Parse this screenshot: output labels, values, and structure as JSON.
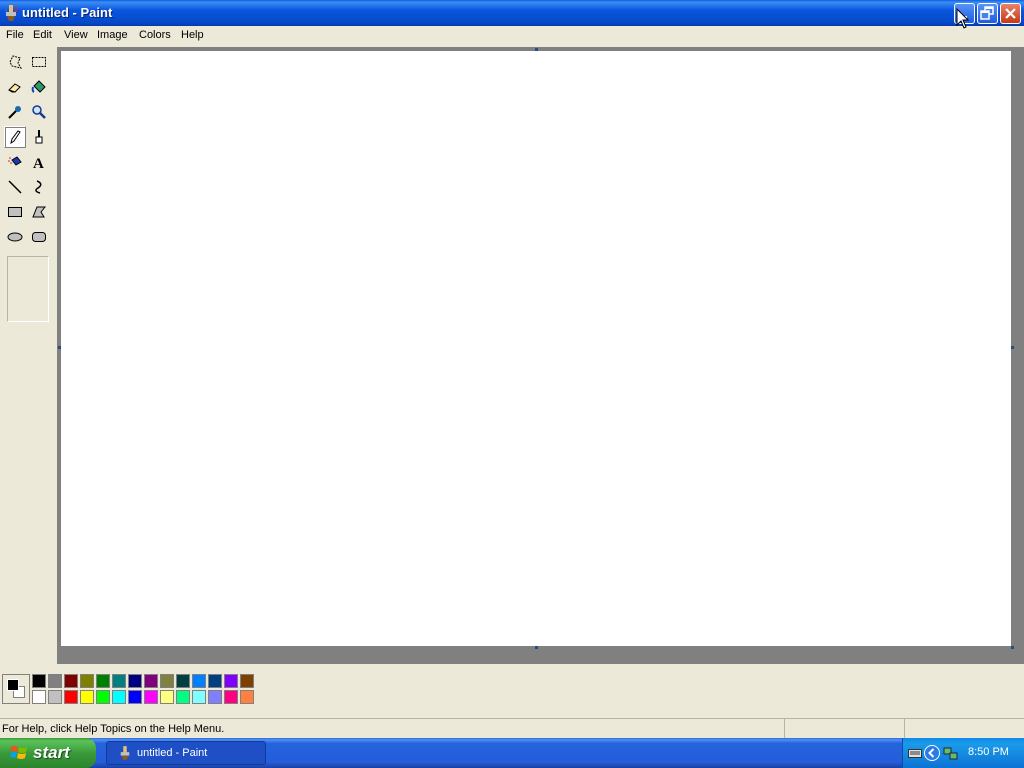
{
  "window": {
    "title": "untitled - Paint"
  },
  "menu": [
    "File",
    "Edit",
    "View",
    "Image",
    "Colors",
    "Help"
  ],
  "tools": [
    "free-form-select",
    "select",
    "eraser",
    "fill-with-color",
    "pick-color",
    "magnifier",
    "pencil",
    "brush",
    "airbrush",
    "text",
    "line",
    "curve",
    "rectangle",
    "polygon",
    "ellipse",
    "rounded-rectangle"
  ],
  "selected_tool": "pencil",
  "palette": {
    "foreground": "#000000",
    "background": "#FFFFFF",
    "top_row": [
      "#000000",
      "#808080",
      "#800000",
      "#808000",
      "#008000",
      "#008080",
      "#000080",
      "#800080",
      "#808040",
      "#004040",
      "#0080FF",
      "#004080",
      "#8000FF",
      "#804000"
    ],
    "bottom_row": [
      "#FFFFFF",
      "#C0C0C0",
      "#FF0000",
      "#FFFF00",
      "#00FF00",
      "#00FFFF",
      "#0000FF",
      "#FF00FF",
      "#FFFF80",
      "#00FF80",
      "#80FFFF",
      "#8080FF",
      "#FF0080",
      "#FF8040"
    ]
  },
  "status": {
    "help_text": "For Help, click Help Topics on the Help Menu."
  },
  "taskbar": {
    "start_label": "start",
    "task_label": "untitled - Paint",
    "clock": "8:50 PM"
  }
}
